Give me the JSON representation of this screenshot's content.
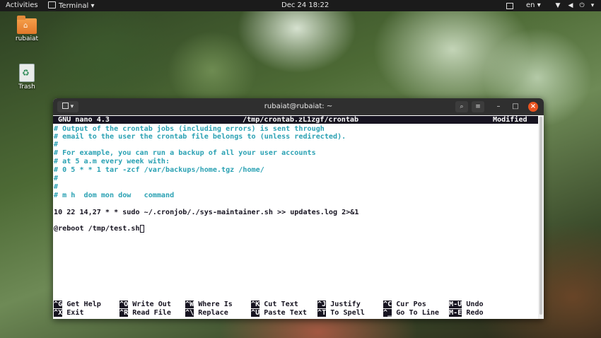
{
  "topbar": {
    "activities": "Activities",
    "app_name": "Terminal",
    "app_menu_arrow": "▾",
    "clock": "Dec 24  18:22",
    "language": "en",
    "language_arrow": "▾"
  },
  "desktop": {
    "icons": [
      {
        "label": "rubaiat",
        "icon": "home-folder-icon"
      },
      {
        "label": "Trash",
        "icon": "trash-icon"
      }
    ]
  },
  "window": {
    "title": "rubaiat@rubaiat: ~",
    "menu_arrow": "▾",
    "minimize": "–",
    "maximize": "□",
    "close": "×"
  },
  "nano": {
    "header_app": "GNU nano 4.3",
    "header_file": "/tmp/crontab.zL1zgf/crontab",
    "header_status": "Modified",
    "lines": [
      {
        "text": "# Output of the crontab jobs (including errors) is sent through",
        "type": "comment"
      },
      {
        "text": "# email to the user the crontab file belongs to (unless redirected).",
        "type": "comment"
      },
      {
        "text": "#",
        "type": "comment"
      },
      {
        "text": "# For example, you can run a backup of all your user accounts",
        "type": "comment"
      },
      {
        "text": "# at 5 a.m every week with:",
        "type": "comment"
      },
      {
        "text": "# 0 5 * * 1 tar -zcf /var/backups/home.tgz /home/",
        "type": "comment"
      },
      {
        "text": "#",
        "type": "comment"
      },
      {
        "text": "#",
        "type": "comment"
      },
      {
        "text": "# m h  dom mon dow   command",
        "type": "comment"
      },
      {
        "text": "",
        "type": "code"
      },
      {
        "text": "10 22 14,27 * * sudo ~/.cronjob/./sys-maintainer.sh >> updates.log 2>&1",
        "type": "code"
      },
      {
        "text": "",
        "type": "code"
      },
      {
        "text": "@reboot /tmp/test.sh",
        "type": "code"
      }
    ],
    "shortcuts": [
      {
        "key": "^G",
        "label": "Get Help"
      },
      {
        "key": "^O",
        "label": "Write Out"
      },
      {
        "key": "^W",
        "label": "Where Is"
      },
      {
        "key": "^K",
        "label": "Cut Text"
      },
      {
        "key": "^J",
        "label": "Justify"
      },
      {
        "key": "^C",
        "label": "Cur Pos"
      },
      {
        "key": "M-U",
        "label": "Undo"
      },
      {
        "key": "^X",
        "label": "Exit"
      },
      {
        "key": "^R",
        "label": "Read File"
      },
      {
        "key": "^\\",
        "label": "Replace"
      },
      {
        "key": "^U",
        "label": "Paste Text"
      },
      {
        "key": "^T",
        "label": "To Spell"
      },
      {
        "key": "^_",
        "label": "Go To Line"
      },
      {
        "key": "M-E",
        "label": "Redo"
      }
    ]
  },
  "colors": {
    "comment": "#2aa1b3",
    "text": "#171421",
    "titlebar": "#2f2f2f",
    "close": "#e95420"
  }
}
